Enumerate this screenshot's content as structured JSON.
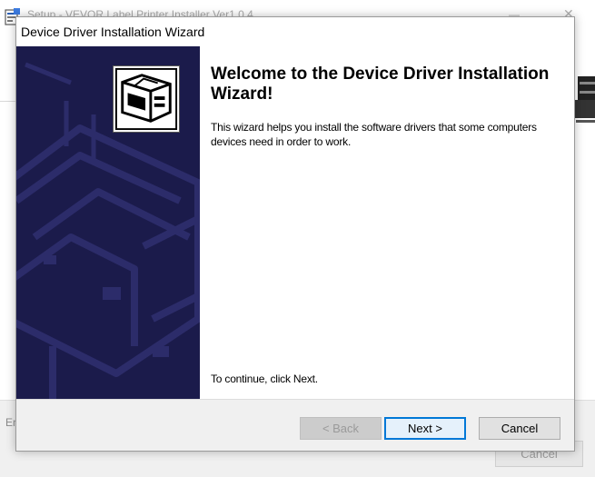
{
  "background_window": {
    "title": "Setup - VEVOR Label Printer Installer Ver1.0.4",
    "status_text": "En",
    "cancel_label": "Cancel",
    "icons": [
      "installer-icon",
      "minimize-icon",
      "close-icon",
      "printer-icon"
    ]
  },
  "dialog": {
    "title": "Device Driver Installation Wizard",
    "heading": "Welcome to the Device Driver Installation Wizard!",
    "description": "This wizard helps you install the software drivers that some computers devices need in order to work.",
    "continue_text": "To continue, click Next.",
    "buttons": {
      "back": "< Back",
      "next": "Next >",
      "cancel": "Cancel"
    },
    "icons": [
      "hardware-wizard-icon"
    ]
  },
  "colors": {
    "side_panel": "#1b1b4b",
    "accent_focus": "#0078d7"
  }
}
